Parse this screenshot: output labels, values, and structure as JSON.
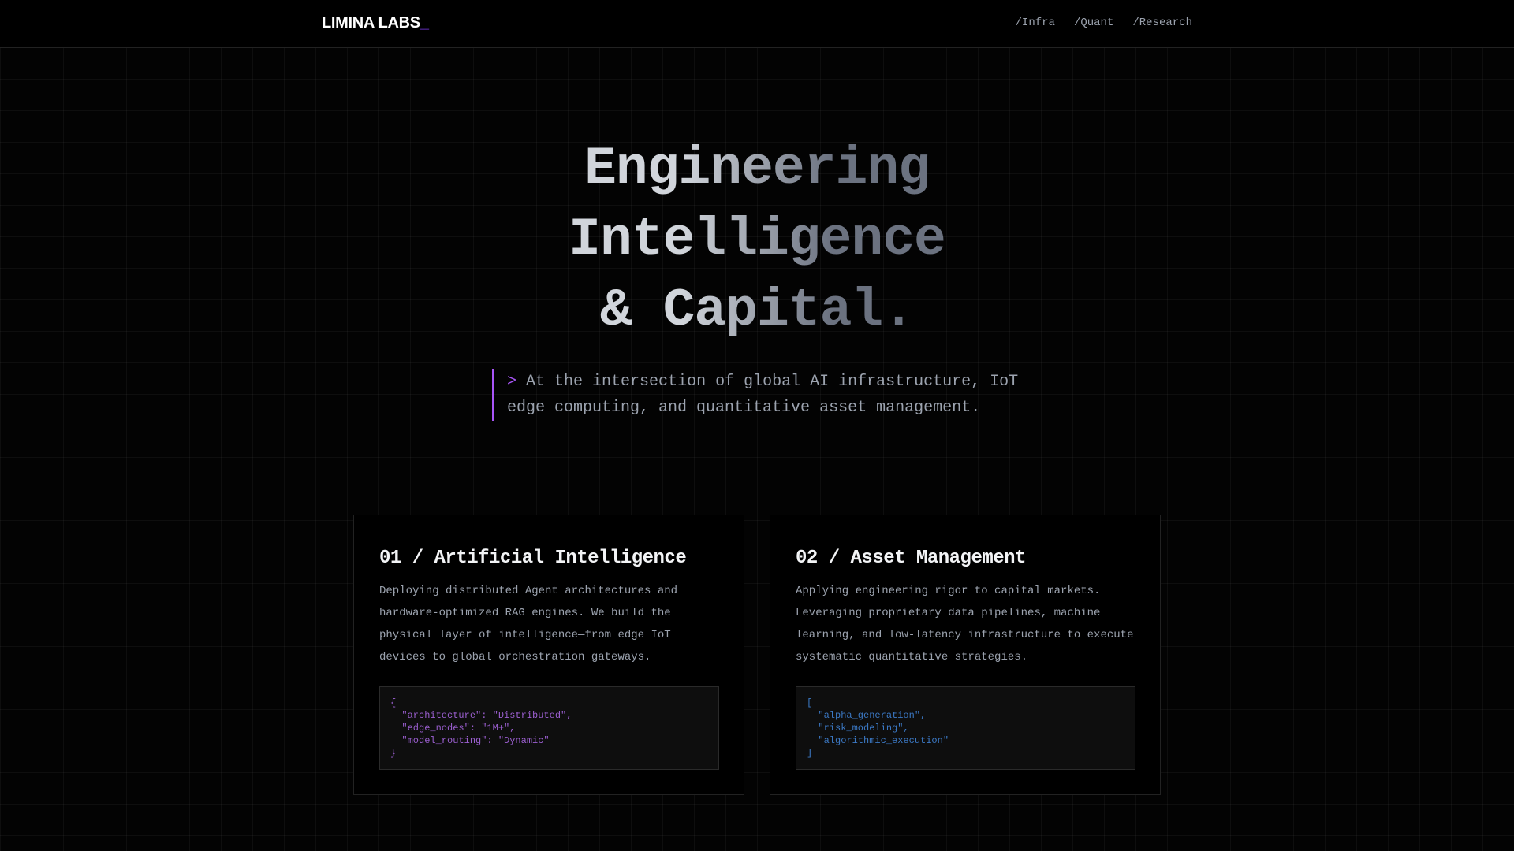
{
  "header": {
    "logo": "LIMINA LABS",
    "cursor": "_",
    "nav": [
      "/Infra",
      "/Quant",
      "/Research"
    ]
  },
  "hero": {
    "title_lines": [
      "Engineering",
      "Intelligence",
      "& Capital."
    ],
    "prompt": ">",
    "subtitle": "At the intersection of global AI infrastructure, IoT edge computing, and quantitative asset management."
  },
  "cards": [
    {
      "title": "01 / Artificial Intelligence",
      "body": "Deploying distributed Agent architectures and hardware-optimized RAG engines. We build the physical layer of intelligence—from edge IoT devices to global orchestration gateways.",
      "code": "{\n  \"architecture\": \"Distributed\",\n  \"edge_nodes\": \"1M+\",\n  \"model_routing\": \"Dynamic\"\n}"
    },
    {
      "title": "02 / Asset Management",
      "body": "Applying engineering rigor to capital markets. Leveraging proprietary data pipelines, machine learning, and low-latency infrastructure to execute systematic quantitative strategies.",
      "code": "[\n  \"alpha_generation\",\n  \"risk_modeling\",\n  \"algorithmic_execution\"\n]"
    }
  ],
  "colors": {
    "accent": "#a855f7",
    "code_purple": "#9b5fd0",
    "code_blue": "#3b78c4"
  }
}
